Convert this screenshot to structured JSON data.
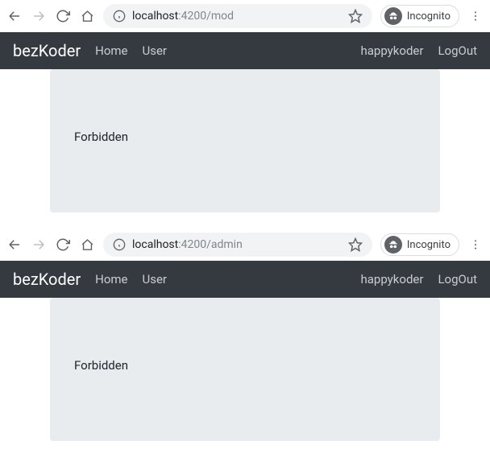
{
  "window1": {
    "url_host": "localhost",
    "url_port_path": ":4200/mod",
    "incognito_label": "Incognito",
    "navbar": {
      "brand": "bezKoder",
      "left": [
        "Home",
        "User"
      ],
      "right": [
        "happykoder",
        "LogOut"
      ]
    },
    "content": "Forbidden"
  },
  "window2": {
    "url_host": "localhost",
    "url_port_path": ":4200/admin",
    "incognito_label": "Incognito",
    "navbar": {
      "brand": "bezKoder",
      "left": [
        "Home",
        "User"
      ],
      "right": [
        "happykoder",
        "LogOut"
      ]
    },
    "content": "Forbidden"
  }
}
